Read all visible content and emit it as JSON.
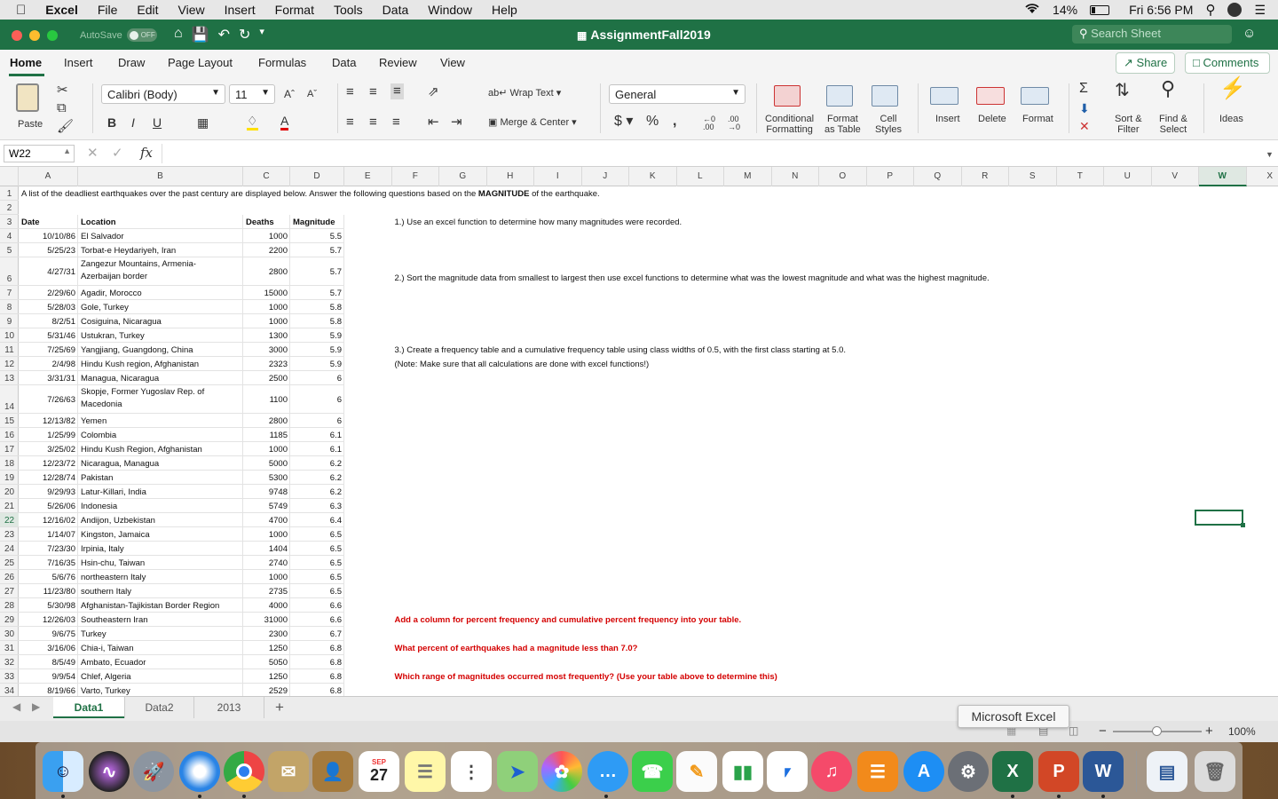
{
  "menubar": {
    "app": "Excel",
    "items": [
      "File",
      "Edit",
      "View",
      "Insert",
      "Format",
      "Tools",
      "Data",
      "Window",
      "Help"
    ],
    "battery": "14%",
    "clock": "Fri 6:56 PM"
  },
  "titlebar": {
    "autosave_label": "AutoSave",
    "autosave_state": "OFF",
    "document_title": "AssignmentFall2019",
    "search_placeholder": "Search Sheet"
  },
  "ribbon_tabs": [
    "Home",
    "Insert",
    "Draw",
    "Page Layout",
    "Formulas",
    "Data",
    "Review",
    "View"
  ],
  "share_label": "Share",
  "comments_label": "Comments",
  "ribbon": {
    "paste_label": "Paste",
    "font_name": "Calibri (Body)",
    "font_size": "11",
    "wrap_text": "Wrap Text",
    "merge_center": "Merge & Center",
    "number_format": "General",
    "conditional_formatting": "Conditional\nFormatting",
    "format_as_table": "Format\nas Table",
    "cell_styles": "Cell\nStyles",
    "insert": "Insert",
    "delete": "Delete",
    "format": "Format",
    "sort_filter": "Sort &\nFilter",
    "find_select": "Find &\nSelect",
    "ideas": "Ideas"
  },
  "formula_bar": {
    "name_box": "W22",
    "fx": "fx",
    "content": ""
  },
  "columns": [
    "A",
    "B",
    "C",
    "D",
    "E",
    "F",
    "G",
    "H",
    "I",
    "J",
    "K",
    "L",
    "M",
    "N",
    "O",
    "P",
    "Q",
    "R",
    "S",
    "T",
    "U",
    "V",
    "W",
    "X"
  ],
  "selected_column": "W",
  "rows": [
    "1",
    "2",
    "3",
    "4",
    "5",
    "6",
    "7",
    "8",
    "9",
    "10",
    "11",
    "12",
    "13",
    "14",
    "15",
    "16",
    "17",
    "18",
    "19",
    "20",
    "21",
    "22",
    "23",
    "24",
    "25",
    "26",
    "27",
    "28",
    "29",
    "30",
    "31",
    "32",
    "33",
    "34"
  ],
  "selected_row": "22",
  "sheet": {
    "intro_a": "A list of the deadliest earthquakes over the past century are displayed below.  Answer the following questions based on the ",
    "intro_b": "MAGNITUDE",
    "intro_c": " of the earthquake.",
    "headers": {
      "date": "Date",
      "location": "Location",
      "deaths": "Deaths",
      "magnitude": "Magnitude"
    },
    "data": [
      [
        "10/10/86",
        "El Salvador",
        "1000",
        "5.5"
      ],
      [
        "5/25/23",
        "Torbat-e Heydariyeh, Iran",
        "2200",
        "5.7"
      ],
      [
        "4/27/31",
        "Zangezur Mountains, Armenia-\nAzerbaijan border",
        "2800",
        "5.7"
      ],
      [
        "2/29/60",
        "Agadir, Morocco",
        "15000",
        "5.7"
      ],
      [
        "5/28/03",
        "Gole, Turkey",
        "1000",
        "5.8"
      ],
      [
        "8/2/51",
        "Cosiguina, Nicaragua",
        "1000",
        "5.8"
      ],
      [
        "5/31/46",
        "Ustukran, Turkey",
        "1300",
        "5.9"
      ],
      [
        "7/25/69",
        "Yangjiang, Guangdong, China",
        "3000",
        "5.9"
      ],
      [
        "2/4/98",
        "Hindu Kush region, Afghanistan",
        "2323",
        "5.9"
      ],
      [
        "3/31/31",
        "Managua, Nicaragua",
        "2500",
        "6"
      ],
      [
        "7/26/63",
        "Skopje, Former Yugoslav Rep. of\nMacedonia",
        "1100",
        "6"
      ],
      [
        "12/13/82",
        "Yemen",
        "2800",
        "6"
      ],
      [
        "1/25/99",
        "Colombia",
        "1185",
        "6.1"
      ],
      [
        "3/25/02",
        "Hindu Kush Region, Afghanistan",
        "1000",
        "6.1"
      ],
      [
        "12/23/72",
        "Nicaragua, Managua",
        "5000",
        "6.2"
      ],
      [
        "12/28/74",
        "Pakistan",
        "5300",
        "6.2"
      ],
      [
        "9/29/93",
        "Latur-Killari, India",
        "9748",
        "6.2"
      ],
      [
        "5/26/06",
        "Indonesia",
        "5749",
        "6.3"
      ],
      [
        "12/16/02",
        "Andijon, Uzbekistan",
        "4700",
        "6.4"
      ],
      [
        "1/14/07",
        "Kingston, Jamaica",
        "1000",
        "6.5"
      ],
      [
        "7/23/30",
        "Irpinia, Italy",
        "1404",
        "6.5"
      ],
      [
        "7/16/35",
        "Hsin-chu, Taiwan",
        "2740",
        "6.5"
      ],
      [
        "5/6/76",
        "northeastern Italy",
        "1000",
        "6.5"
      ],
      [
        "11/23/80",
        "southern Italy",
        "2735",
        "6.5"
      ],
      [
        "5/30/98",
        "Afghanistan-Tajikistan Border Region",
        "4000",
        "6.6"
      ],
      [
        "12/26/03",
        "Southeastern Iran",
        "31000",
        "6.6"
      ],
      [
        "9/6/75",
        "Turkey",
        "2300",
        "6.7"
      ],
      [
        "3/16/06",
        "Chia-i, Taiwan",
        "1250",
        "6.8"
      ],
      [
        "8/5/49",
        "Ambato, Ecuador",
        "5050",
        "6.8"
      ],
      [
        "9/9/54",
        "Chlef, Algeria",
        "1250",
        "6.8"
      ],
      [
        "8/19/66",
        "Varto, Turkey",
        "2529",
        "6.8"
      ]
    ],
    "q1": "1.) Use an excel function to determine how many magnitudes were recorded.",
    "q2": "2.) Sort the magnitude data from smallest to largest then use excel functions to determine what was the lowest magnitude and what was the highest magnitude.",
    "q3": "3.) Create a frequency table and a cumulative frequency table using class widths of 0.5, with the first class starting at 5.0.",
    "q3_note": "(Note:  Make sure that all calculations are done with excel functions!)",
    "red1": "Add a column for percent frequency and cumulative percent frequency into your table.",
    "red2": "What percent of earthquakes had a magnitude less than 7.0?",
    "red3": "Which range of magnitudes occurred most frequently?  (Use your table above to determine this)"
  },
  "sheet_tabs": [
    "Data1",
    "Data2",
    "2013"
  ],
  "active_sheet": "Data1",
  "tooltip": "Microsoft Excel",
  "zoom": "100%",
  "dock": {
    "calendar_month": "SEP",
    "calendar_day": "27"
  },
  "colors": {
    "excel_green": "#1f7145",
    "question_red": "#d40000"
  }
}
